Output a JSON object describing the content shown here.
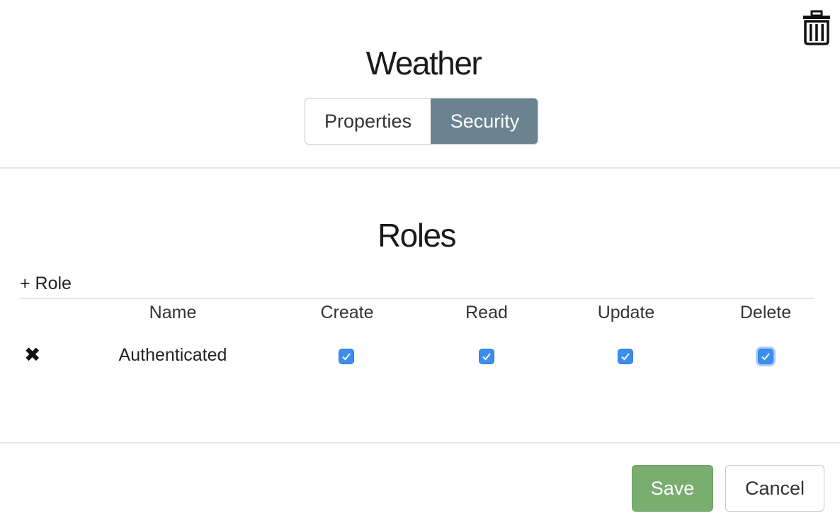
{
  "header": {
    "title": "Weather",
    "delete_icon": "trash-icon"
  },
  "tabs": [
    {
      "label": "Properties",
      "active": false
    },
    {
      "label": "Security",
      "active": true
    }
  ],
  "roles": {
    "heading": "Roles",
    "add_label": "+ Role",
    "columns": [
      "Name",
      "Create",
      "Read",
      "Update",
      "Delete"
    ],
    "rows": [
      {
        "remove_icon": "remove-x-icon",
        "name": "Authenticated",
        "create": true,
        "read": true,
        "update": true,
        "delete": true
      }
    ]
  },
  "footer": {
    "save_label": "Save",
    "cancel_label": "Cancel"
  },
  "colors": {
    "active_tab": "#6b8390",
    "save_button": "#7aad70",
    "checkbox": "#3b8ef0"
  }
}
